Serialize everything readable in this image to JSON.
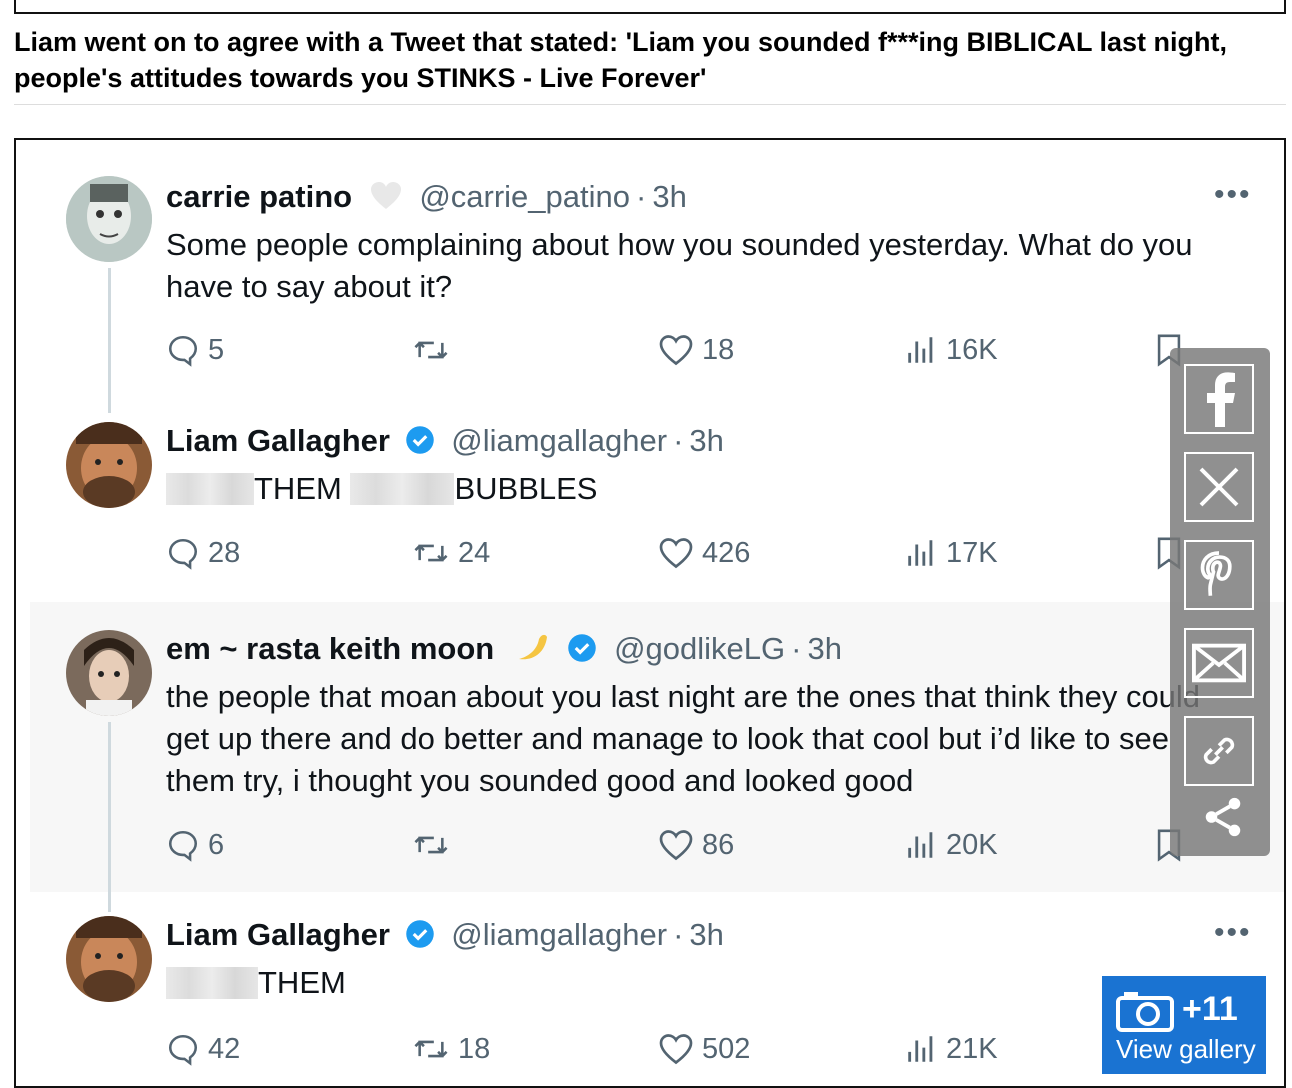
{
  "caption": "Liam went on to agree with a Tweet that stated: 'Liam you sounded f***ing BIBLICAL last night, people's attitudes towards you STINKS - Live Forever'",
  "tweets": [
    {
      "name": "carrie patino",
      "handle": "@carrie_patino",
      "dot": "·",
      "time": "3h",
      "body": "Some people complaining about how you sounded yesterday. What do you have to say about it?",
      "replies": "5",
      "retweets": "",
      "likes": "18",
      "views": "16K",
      "more": "•••"
    },
    {
      "name": "Liam Gallagher",
      "handle": "@liamgallagher",
      "dot": "·",
      "time": "3h",
      "body_a": "THEM",
      "body_b": "BUBBLES",
      "replies": "28",
      "retweets": "24",
      "likes": "426",
      "views": "17K",
      "more": "•••"
    },
    {
      "name": "em ~ rasta keith moon",
      "handle": "@godlikeLG",
      "dot": "·",
      "time": "3h",
      "body": "the people that moan about you last night are the ones that think they could get up there and do better and manage to look that cool but i’d like to see them try, i thought you sounded good and looked good",
      "replies": "6",
      "retweets": "",
      "likes": "86",
      "views": "20K",
      "more": "•••"
    },
    {
      "name": "Liam Gallagher",
      "handle": "@liamgallagher",
      "dot": "·",
      "time": "3h",
      "body_a": "THEM",
      "replies": "42",
      "retweets": "18",
      "likes": "502",
      "views": "21K",
      "more": "•••"
    }
  ],
  "share": [
    "facebook-icon",
    "x-icon",
    "pinterest-icon",
    "email-icon",
    "link-icon",
    "share-icon"
  ],
  "gallery": {
    "count": "+11",
    "label": "View gallery"
  },
  "colors": {
    "verified": "#1d9bf0",
    "gallery": "#1a73d2"
  }
}
